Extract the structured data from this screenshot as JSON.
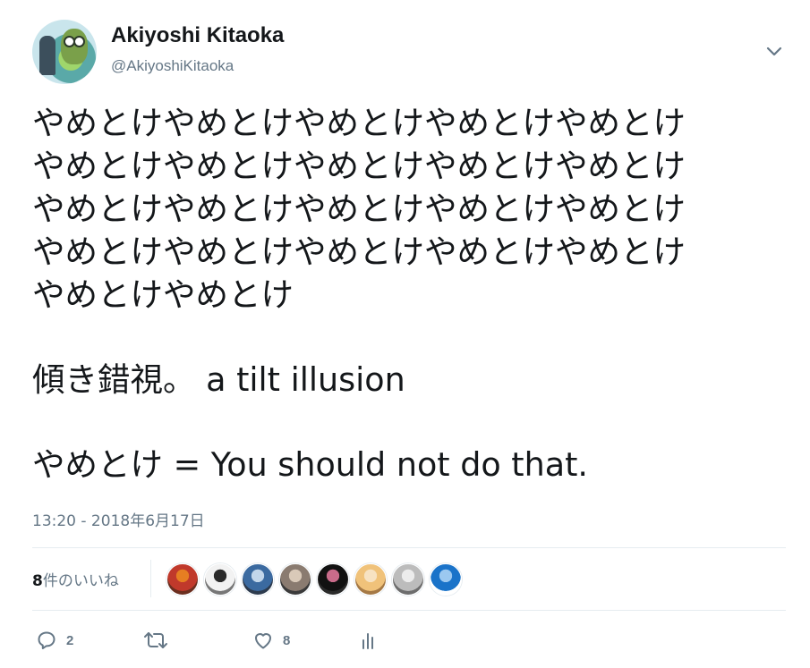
{
  "author": {
    "display_name": "Akiyoshi Kitaoka",
    "handle": "@AkiyoshiKitaoka"
  },
  "tweet": {
    "lines": [
      "やめとけやめとけやめとけやめとけやめとけ",
      "やめとけやめとけやめとけやめとけやめとけ",
      "やめとけやめとけやめとけやめとけやめとけ",
      "やめとけやめとけやめとけやめとけやめとけ",
      "やめとけやめとけ",
      "",
      "傾き錯視。 a tilt illusion",
      "",
      "やめとけ = You should not do that."
    ],
    "timestamp": "13:20 - 2018年6月17日"
  },
  "likes": {
    "count": "8",
    "label": "件のいいね",
    "avatars": [
      {
        "name": "liker-avatar-1",
        "colors": [
          "#c0392b",
          "#e67e22",
          "#6b2e1f"
        ]
      },
      {
        "name": "liker-avatar-2",
        "colors": [
          "#f2f2f2",
          "#2b2b2b",
          "#777777"
        ]
      },
      {
        "name": "liker-avatar-3",
        "colors": [
          "#3b6aa0",
          "#c2d6ea",
          "#2d3b4e"
        ]
      },
      {
        "name": "liker-avatar-4",
        "colors": [
          "#8a7b70",
          "#d9c9b8",
          "#3a3a3a"
        ]
      },
      {
        "name": "liker-avatar-5",
        "colors": [
          "#111111",
          "#c96b8a",
          "#2a2a2a"
        ]
      },
      {
        "name": "liker-avatar-6",
        "colors": [
          "#f0c27a",
          "#f7e2c2",
          "#a57945"
        ]
      },
      {
        "name": "liker-avatar-7",
        "colors": [
          "#bcbcbc",
          "#ececec",
          "#6d6d6d"
        ]
      },
      {
        "name": "liker-avatar-8",
        "colors": [
          "#1a73c9",
          "#9bc8f0",
          "#ffffff"
        ]
      }
    ]
  },
  "actions": {
    "reply_count": "2",
    "retweet_count": "",
    "like_count": "8"
  },
  "colors": {
    "text": "#14171a",
    "secondary": "#657786",
    "divider": "#e6ecf0"
  }
}
